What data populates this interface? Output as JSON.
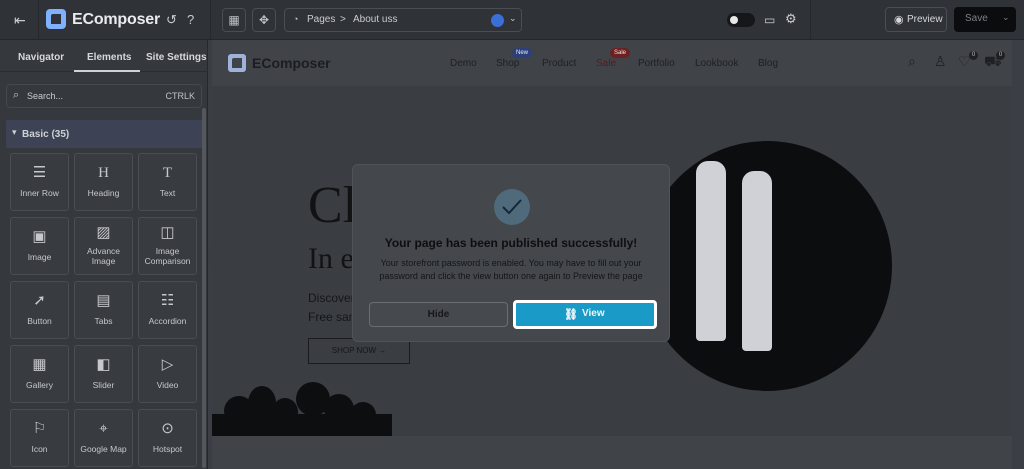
{
  "topbar": {
    "brand": "EComposer",
    "breadcrumb_root": "Pages",
    "breadcrumb_sep": ">",
    "breadcrumb_page": "About uss",
    "preview_label": "Preview",
    "save_label": "Save"
  },
  "sidebar": {
    "tabs": [
      "Navigator",
      "Elements",
      "Site Settings"
    ],
    "active_tab": "Elements",
    "search_placeholder": "Search...",
    "search_shortcut": "CTRLK",
    "category": "Basic (35)",
    "elements": [
      {
        "label": "Inner Row",
        "icon": "inner-row-icon"
      },
      {
        "label": "Heading",
        "icon": "heading-icon"
      },
      {
        "label": "Text",
        "icon": "text-icon"
      },
      {
        "label": "Image",
        "icon": "image-icon"
      },
      {
        "label": "Advance Image",
        "icon": "advance-image-icon"
      },
      {
        "label": "Image Comparison",
        "icon": "image-comparison-icon"
      },
      {
        "label": "Button",
        "icon": "button-icon"
      },
      {
        "label": "Tabs",
        "icon": "tabs-icon"
      },
      {
        "label": "Accordion",
        "icon": "accordion-icon"
      },
      {
        "label": "Gallery",
        "icon": "gallery-icon"
      },
      {
        "label": "Slider",
        "icon": "slider-icon"
      },
      {
        "label": "Video",
        "icon": "video-icon"
      },
      {
        "label": "Icon",
        "icon": "flag-icon"
      },
      {
        "label": "Google Map",
        "icon": "map-icon"
      },
      {
        "label": "Hotspot",
        "icon": "hotspot-icon"
      }
    ]
  },
  "site": {
    "brand": "EComposer",
    "nav": [
      "Demo",
      "Shop",
      "Product",
      "Sale",
      "Portfolio",
      "Lookbook",
      "Blog"
    ],
    "badge_new": "New",
    "badge_sale": "Sale",
    "wishlist_count": "0",
    "cart_count": "0",
    "hero_title": "Cl",
    "hero_sub": "In e",
    "hero_line1": "Discover",
    "hero_line2": "Free sam",
    "shop_now": "SHOP NOW →"
  },
  "modal": {
    "title": "Your page has been published successfully!",
    "description": "Your storefront password is enabled. You may have to fill out your password and click the view button one again to Preview the page",
    "hide_label": "Hide",
    "view_label": "View"
  },
  "colors": {
    "accent": "#1a9ac6",
    "overlay": "#3b3e44"
  }
}
